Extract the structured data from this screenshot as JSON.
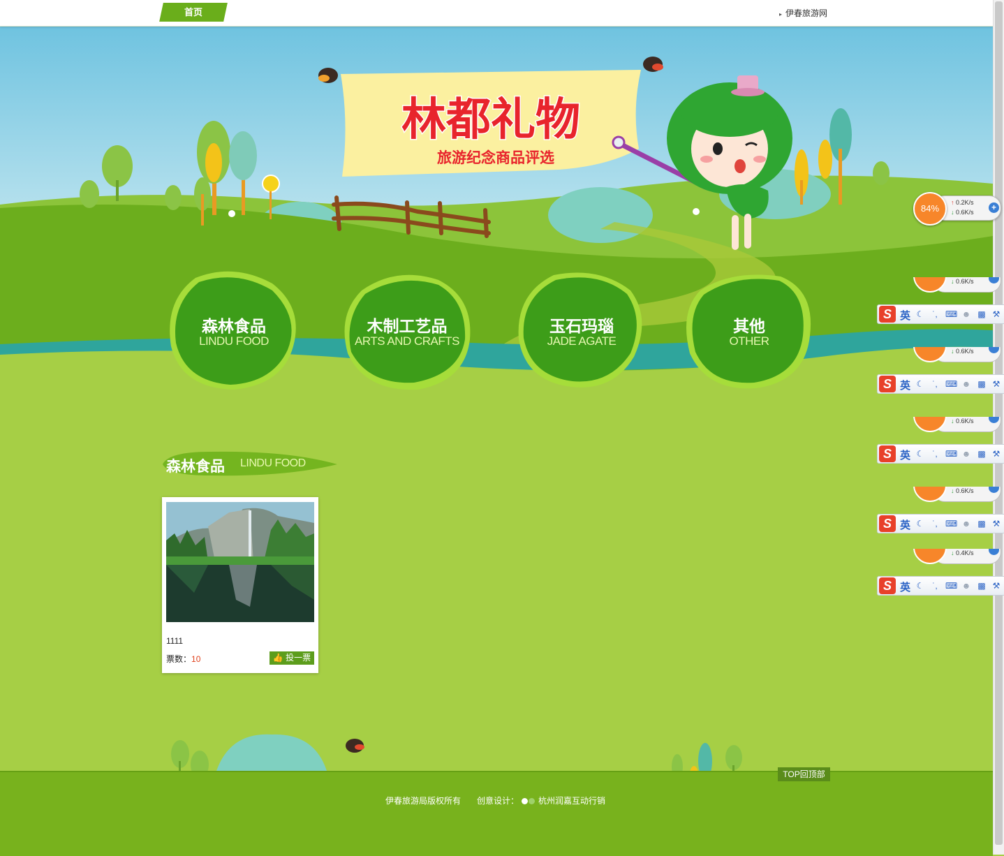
{
  "nav": {
    "home": "首页",
    "site_link": "伊春旅游网"
  },
  "banner": {
    "title": "林都礼物",
    "subtitle": "旅游纪念商品评选"
  },
  "categories": [
    {
      "cn": "森林食品",
      "en": "LINDU FOOD"
    },
    {
      "cn": "木制工艺品",
      "en": "ARTS AND CRAFTS"
    },
    {
      "cn": "玉石玛瑙",
      "en": "JADE AGATE"
    },
    {
      "cn": "其他",
      "en": "OTHER"
    }
  ],
  "section": {
    "cn": "森林食品",
    "en": "LINDU FOOD"
  },
  "products": [
    {
      "name": "1111",
      "votes_label": "票数：",
      "votes": "10",
      "vote_button": "投一票"
    }
  ],
  "footer": {
    "top_button": "TOP回顶部",
    "copyright": "伊春旅游局版权所有",
    "design_label": "创意设计：",
    "designer": "杭州润嘉互动行销"
  },
  "overlays": {
    "netmon": {
      "percent": "84%",
      "up": "0.2K/s",
      "down": "0.6K/s"
    },
    "netmon_fragments": [
      "0.6K/s",
      "0.6K/s",
      "0.6K/s",
      "0.6K/s",
      "0.4K/s"
    ],
    "ime": {
      "logo": "S",
      "lang": "英"
    }
  },
  "colors": {
    "nav_green": "#6aae1b",
    "page_green": "#a6cf45",
    "footer_green": "#78b21d",
    "vote_count": "#e0401c"
  }
}
